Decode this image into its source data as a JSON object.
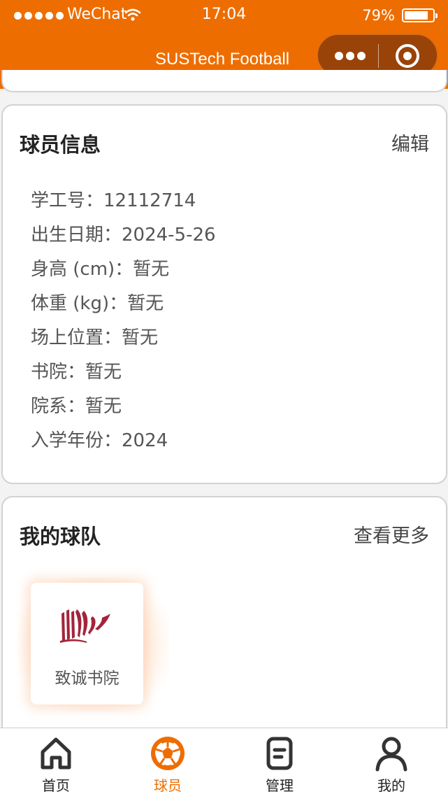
{
  "status_bar": {
    "carrier": "WeChat",
    "time": "17:04",
    "battery_percent": "79%",
    "battery_level": 0.79
  },
  "header": {
    "title": "SUSTech Football",
    "menu_icon": "more-dots-icon",
    "close_icon": "target-circle-icon",
    "color": "#ee6d00"
  },
  "player_info": {
    "title": "球员信息",
    "edit_label": "编辑",
    "fields": [
      "学工号：12112714",
      "出生日期：2024-5-26",
      "身高 (cm)：暂无",
      "体重 (kg)：暂无",
      "场上位置：暂无",
      "书院：暂无",
      "院系：暂无",
      "入学年份：2024"
    ]
  },
  "my_teams": {
    "title": "我的球队",
    "more_label": "查看更多",
    "teams": [
      {
        "name": "致诚书院",
        "logo_icon": "books-logo-icon",
        "logo_color": "#a3243b"
      }
    ]
  },
  "tabbar": {
    "active_color": "#ee6d00",
    "items": [
      {
        "label": "首页",
        "icon": "home-icon"
      },
      {
        "label": "球员",
        "icon": "football-icon"
      },
      {
        "label": "管理",
        "icon": "document-icon"
      },
      {
        "label": "我的",
        "icon": "user-icon"
      }
    ]
  }
}
